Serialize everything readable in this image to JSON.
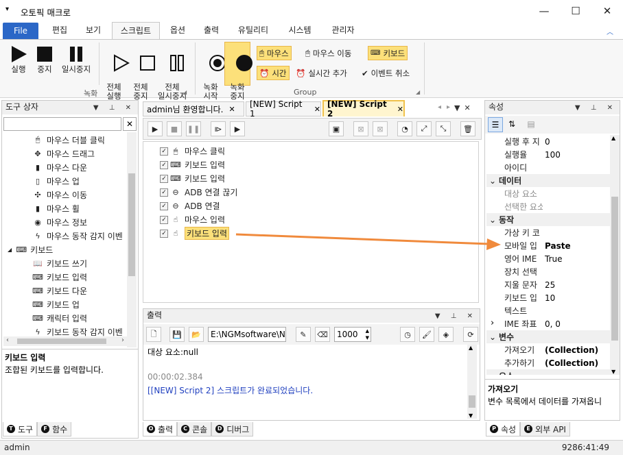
{
  "window": {
    "title": "오토픽 매크로",
    "menu_icon": "▾",
    "minimize": "—",
    "maximize": "☐",
    "close": "✕"
  },
  "menu": {
    "file": "File",
    "tabs": [
      "편집",
      "보기",
      "스크립트",
      "옵션",
      "출력",
      "유틸리티",
      "시스템",
      "관리자"
    ],
    "collapse": "︿"
  },
  "ribbon": {
    "record_group": {
      "label": "녹화",
      "run": "실행",
      "stop": "중지",
      "pause": "일시중지",
      "run_all": "전체\n실행",
      "stop_all": "전체\n중지",
      "pause_all": "전체\n일시중지"
    },
    "group_group": {
      "label": "Group",
      "rec_start": "녹화\n시작",
      "rec_stop": "녹화\n중지",
      "mouse": "마우스",
      "mouse_move": "마우스 이동",
      "keyboard": "키보드",
      "time": "시간",
      "realtime_add": "실시간 추가",
      "event_cancel": "이벤트 취소"
    }
  },
  "toolbox": {
    "title": "도구 상자",
    "search_placeholder": "",
    "items": [
      "마우스 더블 클릭",
      "마우스 드래그",
      "마우스 다운",
      "마우스 업",
      "마우스 이동",
      "마우스 휠",
      "마우스 정보",
      "마우스 동작 감지 이벤",
      "키보드",
      "키보드 쓰기",
      "키보드 입력",
      "키보드 다운",
      "키보드 업",
      "캐릭터 입력",
      "키보드 동작 감지 이벤"
    ],
    "desc_title": "키보드 입력",
    "desc_text": "조합된 키보드를 입력합니다.",
    "tab_tools": "도구",
    "tab_functions": "함수"
  },
  "doc_tabs": [
    "admin님 환영합니다.",
    "[NEW] Script 1",
    "[NEW] Script 2"
  ],
  "script": {
    "lines": [
      "마우스 클릭",
      "키보드 입력",
      "키보드 입력",
      "ADB 연결 끊기",
      "ADB 연결",
      "마우스 입력",
      "키보드 입력"
    ]
  },
  "output": {
    "title": "출력",
    "path": "E:\\NGMsoftware\\NG",
    "interval": "1000",
    "line1": "대상 요소:null",
    "line2": "00:00:02.384",
    "line3": "[[NEW] Script 2] 스크립트가 완료되었습니다.",
    "tab_output": "출력",
    "tab_console": "콘솔",
    "tab_debug": "디버그"
  },
  "properties": {
    "title": "속성",
    "rows": [
      {
        "k": "실행 후 지",
        "v": "0"
      },
      {
        "k": "실행율",
        "v": "100"
      },
      {
        "k": "아이디",
        "v": ""
      },
      {
        "cat": "데이터"
      },
      {
        "k": "대상 요소",
        "v": "",
        "dim": true
      },
      {
        "k": "선택한 요소",
        "v": "",
        "dim": true
      },
      {
        "cat": "동작"
      },
      {
        "k": "가상 키 코",
        "v": ""
      },
      {
        "k": "모바일 입",
        "v": "Paste",
        "bold": true
      },
      {
        "k": "영어 IME",
        "v": "True"
      },
      {
        "k": "장치 선택",
        "v": ""
      },
      {
        "k": "지울 문자",
        "v": "25"
      },
      {
        "k": "키보드 입",
        "v": "10"
      },
      {
        "k": "텍스트",
        "v": ""
      },
      {
        "k": "IME 좌표",
        "v": "0, 0",
        "expand": true
      },
      {
        "cat": "변수"
      },
      {
        "k": "가져오기",
        "v": "(Collection)",
        "bold": true
      },
      {
        "k": "추가하기",
        "v": "(Collection)",
        "bold": true
      },
      {
        "cat": "요소"
      }
    ],
    "desc_title": "가져오기",
    "desc_text": "변수 목록에서 데이터를 가져옵니",
    "tab_props": "속성",
    "tab_api": "외부 API"
  },
  "status": {
    "user": "admin",
    "time": "9286:41:49"
  },
  "colors": {
    "accent": "#2b67c7",
    "highlight": "#fce07a",
    "arrow": "#f08a3c",
    "output_blue": "#1f3fbf"
  }
}
